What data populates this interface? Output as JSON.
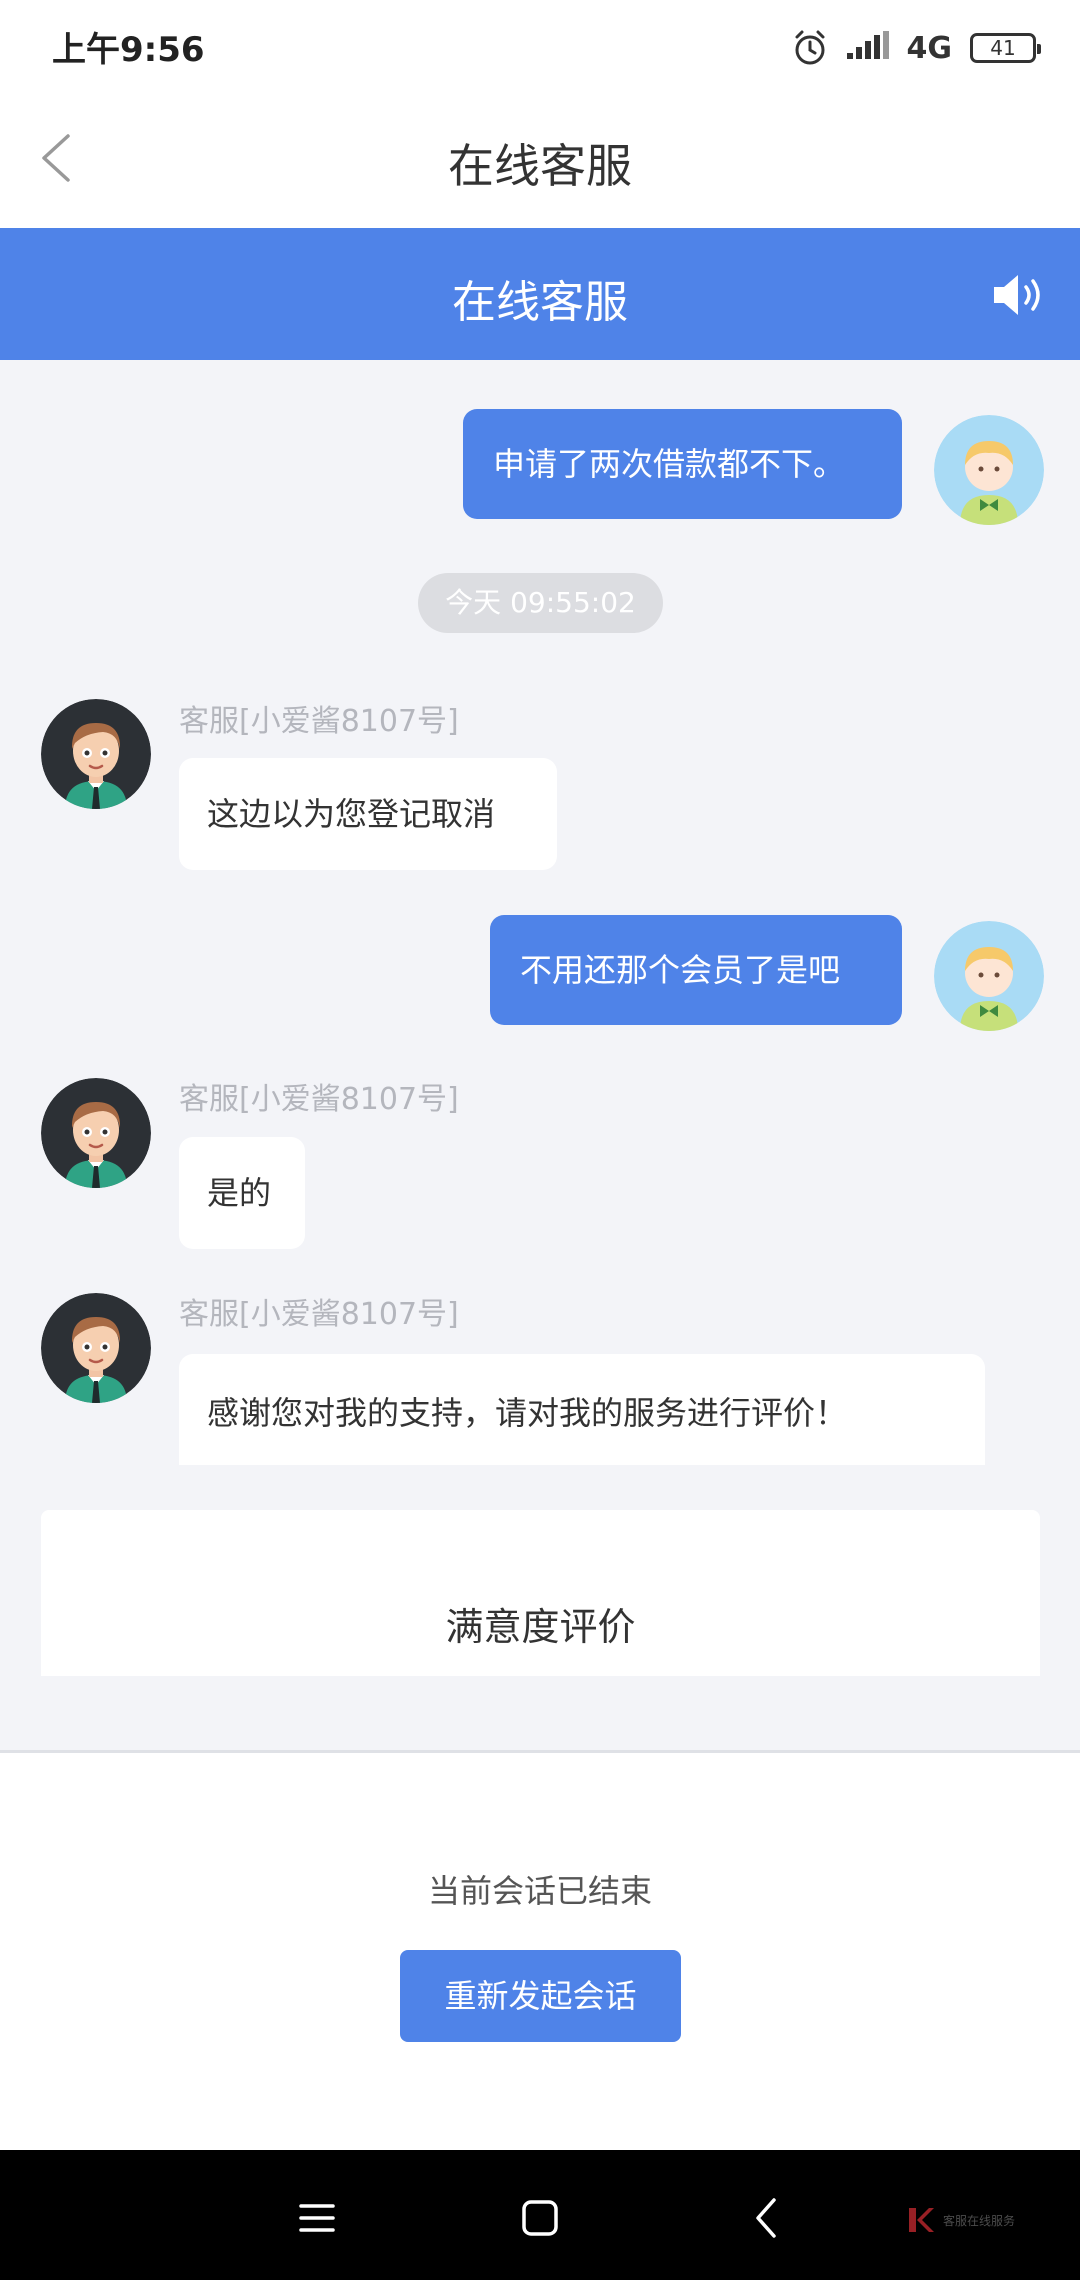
{
  "status_bar": {
    "time": "上午9:56",
    "network": "4G",
    "battery": "41"
  },
  "nav": {
    "title": "在线客服"
  },
  "chat_header": {
    "title": "在线客服"
  },
  "messages": [
    {
      "sender": "user",
      "text": "申请了两次借款都不下。"
    },
    {
      "type": "timestamp",
      "text": "今天 09:55:02"
    },
    {
      "sender": "agent",
      "name": "客服[小爱酱8107号]",
      "text": "这边以为您登记取消"
    },
    {
      "sender": "user",
      "text": "不用还那个会员了是吧"
    },
    {
      "sender": "agent",
      "name": "客服[小爱酱8107号]",
      "text": "是的"
    },
    {
      "sender": "agent",
      "name": "客服[小爱酱8107号]",
      "text": "感谢您对我的支持，请对我的服务进行评价！"
    }
  ],
  "rating": {
    "label": "满意度评价"
  },
  "session": {
    "ended_text": "当前会话已结束",
    "restart_label": "重新发起会话"
  },
  "watermark": {
    "text": "客服在线服务"
  },
  "colors": {
    "accent": "#4f83e8",
    "background": "#f3f4f8"
  }
}
